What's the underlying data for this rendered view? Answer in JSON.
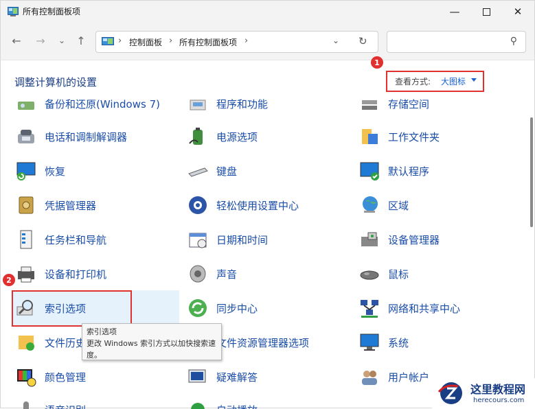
{
  "window": {
    "title": "所有控制面板项"
  },
  "nav": {
    "breadcrumb": [
      "控制面板",
      "所有控制面板项"
    ],
    "search_placeholder": ""
  },
  "header": {
    "heading": "调整计算机的设置",
    "view_by_label": "查看方式:",
    "view_by_value": "大图标"
  },
  "annotations": {
    "badge1": "1",
    "badge2": "2"
  },
  "items": {
    "backup": "备份和还原(Windows 7)",
    "programs": "程序和功能",
    "storage": "存储空间",
    "phone_modem": "电话和调制解调器",
    "power": "电源选项",
    "work_folders": "工作文件夹",
    "recovery": "恢复",
    "keyboard": "键盘",
    "default_programs": "默认程序",
    "credential": "凭据管理器",
    "ease_access": "轻松使用设置中心",
    "region": "区域",
    "taskbar": "任务栏和导航",
    "datetime": "日期和时间",
    "device_manager": "设备管理器",
    "devices_printers": "设备和打印机",
    "sound": "声音",
    "mouse": "鼠标",
    "indexing": "索引选项",
    "sync": "同步中心",
    "network": "网络和共享中心",
    "file_history": "文件历史",
    "explorer_options": "文件资源管理器选项",
    "system": "系统",
    "color": "颜色管理",
    "troubleshoot": "疑难解答",
    "user_accounts": "用户帐户",
    "speech": "语音识别",
    "autoplay": "自动播放"
  },
  "tooltip": {
    "title": "索引选项",
    "body": "更改 Windows 索引方式以加快搜索速度。"
  },
  "watermark": {
    "title": "这里教程网",
    "url": "herecours.com"
  },
  "colors": {
    "link": "#1a4da8",
    "heading": "#1a3e84",
    "accent": "#e03030",
    "selected_bg": "#e5f1fb"
  }
}
